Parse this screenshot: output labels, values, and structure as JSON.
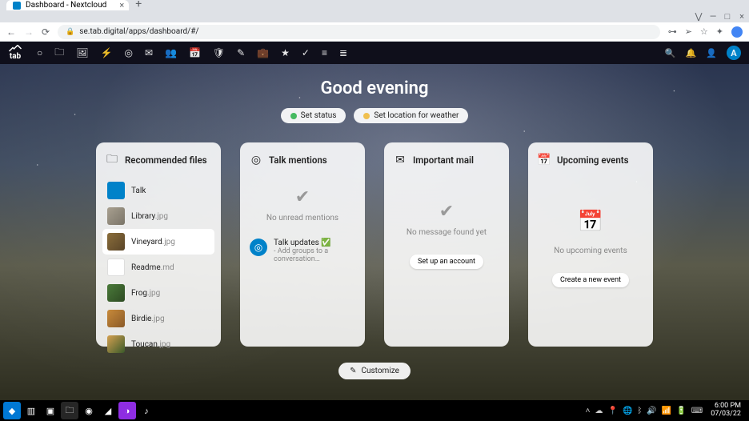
{
  "browser": {
    "tab_title": "Dashboard - Nextcloud",
    "url": "se.tab.digital/apps/dashboard/#/"
  },
  "nc": {
    "logo_text": "tab",
    "avatar_letter": "A"
  },
  "dashboard": {
    "greeting": "Good evening",
    "set_status": "Set status",
    "set_weather": "Set location for weather",
    "customize": "Customize"
  },
  "widgets": {
    "recommended": {
      "title": "Recommended files",
      "items": [
        {
          "name": "Talk",
          "ext": "",
          "thumb": "th-folder"
        },
        {
          "name": "Library",
          "ext": ".jpg",
          "thumb": "th-1"
        },
        {
          "name": "Vineyard",
          "ext": ".jpg",
          "thumb": "th-2",
          "hover": true
        },
        {
          "name": "Readme",
          "ext": ".md",
          "thumb": "th-3"
        },
        {
          "name": "Frog",
          "ext": ".jpg",
          "thumb": "th-4"
        },
        {
          "name": "Birdie",
          "ext": ".jpg",
          "thumb": "th-5"
        },
        {
          "name": "Toucan",
          "ext": ".jpg",
          "thumb": "th-6"
        }
      ]
    },
    "talk": {
      "title": "Talk mentions",
      "empty": "No unread mentions",
      "update_title": "Talk updates ✅",
      "update_sub": "- Add groups to a conversation…"
    },
    "mail": {
      "title": "Important mail",
      "empty": "No message found yet",
      "action": "Set up an account"
    },
    "events": {
      "title": "Upcoming events",
      "empty": "No upcoming events",
      "action": "Create a new event"
    }
  },
  "taskbar": {
    "time": "6:00 PM",
    "date": "07/03/22"
  }
}
